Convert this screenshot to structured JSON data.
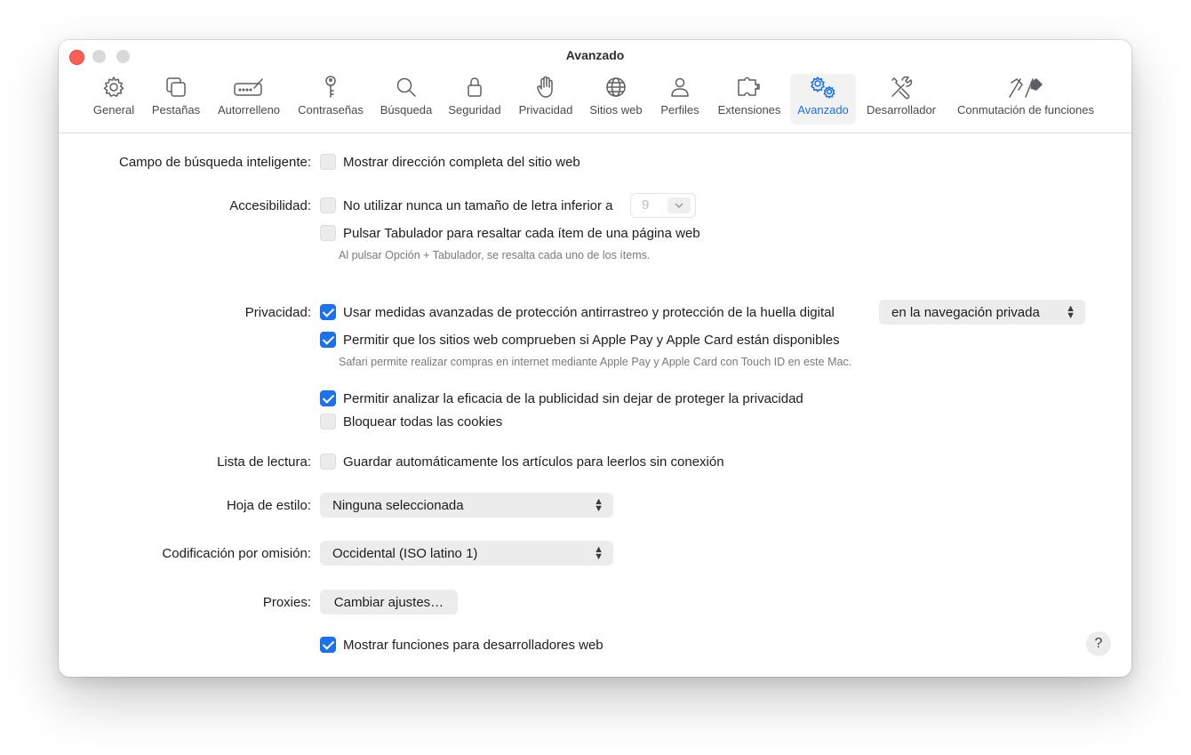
{
  "window": {
    "title": "Avanzado"
  },
  "tabs": [
    {
      "label": "General",
      "icon": "gear-icon"
    },
    {
      "label": "Pestañas",
      "icon": "tabs-icon"
    },
    {
      "label": "Autorrelleno",
      "icon": "autofill-icon"
    },
    {
      "label": "Contraseñas",
      "icon": "key-icon"
    },
    {
      "label": "Búsqueda",
      "icon": "magnifier-icon"
    },
    {
      "label": "Seguridad",
      "icon": "lock-icon"
    },
    {
      "label": "Privacidad",
      "icon": "hand-icon"
    },
    {
      "label": "Sitios web",
      "icon": "globe-icon"
    },
    {
      "label": "Perfiles",
      "icon": "person-icon"
    },
    {
      "label": "Extensiones",
      "icon": "puzzle-icon"
    },
    {
      "label": "Avanzado",
      "icon": "gears-icon",
      "selected": true
    },
    {
      "label": "Desarrollador",
      "icon": "tools-icon"
    },
    {
      "label": "Conmutación de funciones",
      "icon": "flags-icon"
    }
  ],
  "accent_color": "#1a73ee",
  "smart_search": {
    "label": "Campo de búsqueda inteligente:",
    "show_full_address": {
      "label": "Mostrar dirección completa del sitio web",
      "checked": false
    }
  },
  "accessibility": {
    "label": "Accesibilidad:",
    "min_font": {
      "label": "No utilizar nunca un tamaño de letra inferior a",
      "checked": false,
      "value": "9"
    },
    "tab_highlight": {
      "label": "Pulsar Tabulador para resaltar cada ítem de una página web",
      "checked": false
    },
    "note": "Al pulsar Opción + Tabulador, se resalta cada uno de los ítems."
  },
  "privacy": {
    "label": "Privacidad:",
    "advanced_tracking": {
      "label": "Usar medidas avanzadas de protección antirrastreo y protección de la huella digital",
      "checked": true,
      "mode": "en la navegación privada"
    },
    "apple_pay": {
      "label": "Permitir que los sitios web comprueben si Apple Pay y Apple Card están disponibles",
      "checked": true
    },
    "apple_pay_note": "Safari permite realizar compras en internet mediante Apple Pay y Apple Card con Touch ID en este Mac.",
    "ad_measurement": {
      "label": "Permitir analizar la eficacia de la publicidad sin dejar de proteger la privacidad",
      "checked": true
    },
    "block_cookies": {
      "label": "Bloquear todas las cookies",
      "checked": false
    }
  },
  "reading_list": {
    "label": "Lista de lectura:",
    "offline": {
      "label": "Guardar automáticamente los artículos para leerlos sin conexión",
      "checked": false
    }
  },
  "stylesheet": {
    "label": "Hoja de estilo:",
    "value": "Ninguna seleccionada"
  },
  "encoding": {
    "label": "Codificación por omisión:",
    "value": "Occidental (ISO latino 1)"
  },
  "proxies": {
    "label": "Proxies:",
    "button": "Cambiar ajustes…"
  },
  "developer": {
    "label": "Mostrar funciones para desarrolladores web",
    "checked": true
  },
  "help": {
    "label": "?"
  }
}
